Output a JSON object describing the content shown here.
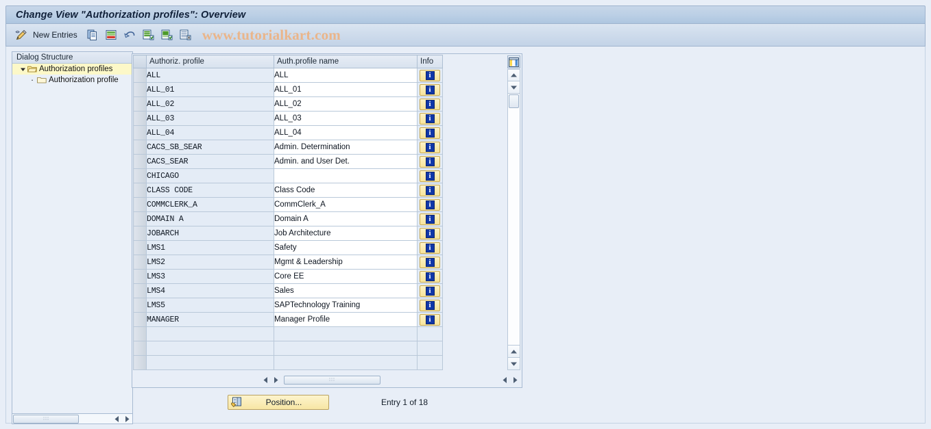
{
  "window": {
    "title": "Change View \"Authorization profiles\": Overview"
  },
  "toolbar": {
    "items": [
      {
        "name": "display-change-icon",
        "label": ""
      },
      {
        "name": "new-entries-button",
        "label": "New Entries"
      },
      {
        "name": "copy-as-icon",
        "label": ""
      },
      {
        "name": "delete-icon",
        "label": ""
      },
      {
        "name": "undo-icon",
        "label": ""
      },
      {
        "name": "select-all-icon",
        "label": ""
      },
      {
        "name": "select-block-icon",
        "label": ""
      },
      {
        "name": "deselect-all-icon",
        "label": ""
      }
    ],
    "new_entries_label": "New Entries",
    "watermark": "www.tutorialkart.com"
  },
  "sidebar": {
    "header": "Dialog Structure",
    "items": [
      {
        "label": "Authorization profiles",
        "selected": true,
        "level": 0,
        "expanded": true
      },
      {
        "label": "Authorization profile",
        "selected": false,
        "level": 1,
        "expanded": false
      }
    ]
  },
  "table": {
    "columns": [
      "Authoriz. profile",
      "Auth.profile name",
      "Info"
    ],
    "info_glyph": "i",
    "rows": [
      {
        "profile": "ALL",
        "name": "ALL"
      },
      {
        "profile": "ALL_01",
        "name": "ALL_01"
      },
      {
        "profile": "ALL_02",
        "name": "ALL_02"
      },
      {
        "profile": "ALL_03",
        "name": "ALL_03"
      },
      {
        "profile": "ALL_04",
        "name": "ALL_04"
      },
      {
        "profile": "CACS_SB_SEAR",
        "name": "Admin. Determination"
      },
      {
        "profile": "CACS_SEAR",
        "name": "Admin. and User Det."
      },
      {
        "profile": "CHICAGO",
        "name": ""
      },
      {
        "profile": "CLASS CODE",
        "name": "Class Code"
      },
      {
        "profile": "COMMCLERK_A",
        "name": "CommClerk_A"
      },
      {
        "profile": "DOMAIN A",
        "name": "Domain A"
      },
      {
        "profile": "JOBARCH",
        "name": "Job Architecture"
      },
      {
        "profile": "LMS1",
        "name": "Safety"
      },
      {
        "profile": "LMS2",
        "name": "Mgmt & Leadership"
      },
      {
        "profile": "LMS3",
        "name": "Core EE"
      },
      {
        "profile": "LMS4",
        "name": "Sales"
      },
      {
        "profile": "LMS5",
        "name": "SAPTechnology Training"
      },
      {
        "profile": "MANAGER",
        "name": "Manager Profile"
      }
    ],
    "empty_row_count": 3
  },
  "footer": {
    "position_label": "Position...",
    "entry_count": "Entry 1 of 18"
  },
  "colors": {
    "title_bar": "#aec6e0",
    "selected_tree_row": "#fcf8c8",
    "info_button": "#f7e49a",
    "watermark": "#eab58a",
    "background": "#e8eef7"
  }
}
